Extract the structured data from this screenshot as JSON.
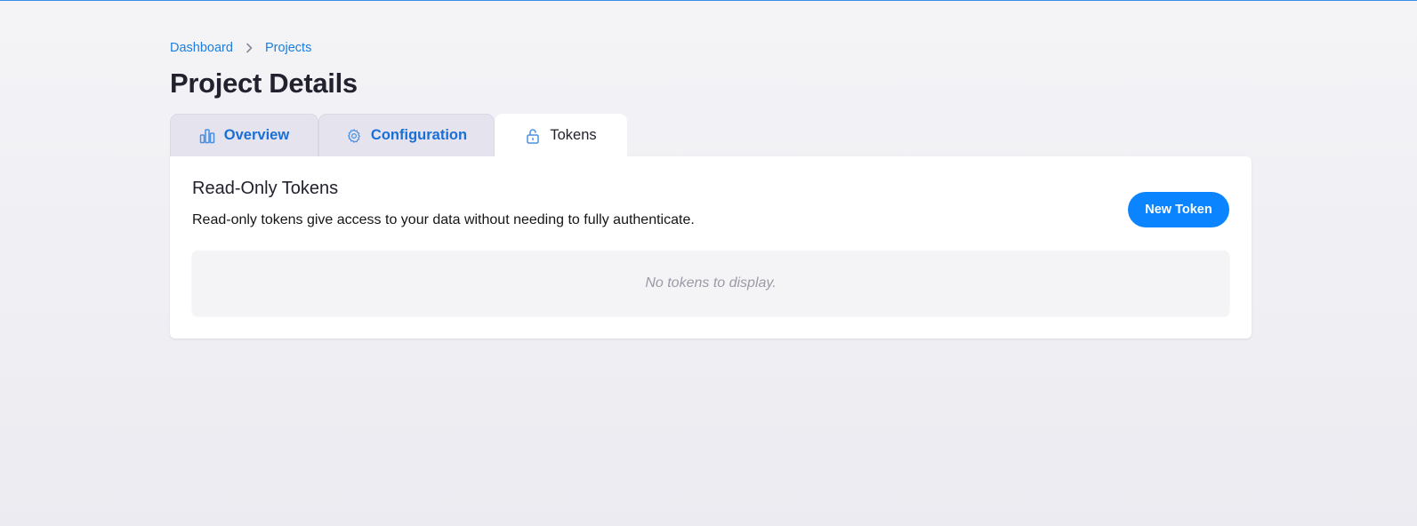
{
  "breadcrumb": {
    "items": [
      {
        "label": "Dashboard"
      },
      {
        "label": "Projects"
      }
    ]
  },
  "page": {
    "title": "Project Details"
  },
  "tabs": [
    {
      "label": "Overview",
      "icon": "chart-icon",
      "active": false
    },
    {
      "label": "Configuration",
      "icon": "gear-icon",
      "active": false
    },
    {
      "label": "Tokens",
      "icon": "unlock-icon",
      "active": true
    }
  ],
  "tokens_panel": {
    "title": "Read-Only Tokens",
    "description": "Read-only tokens give access to your data without needing to fully authenticate.",
    "new_button_label": "New Token",
    "empty_message": "No tokens to display."
  },
  "colors": {
    "accent": "#0a84ff",
    "link": "#1a7fe0",
    "title": "#22212e"
  }
}
